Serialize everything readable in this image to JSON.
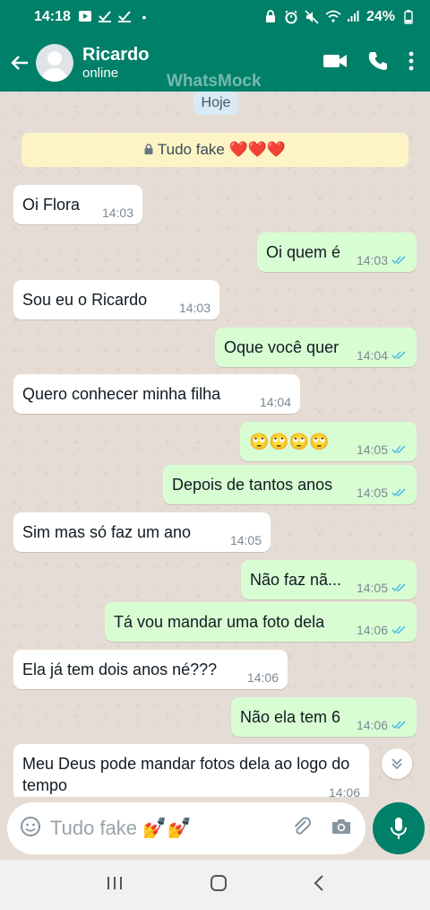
{
  "status_bar": {
    "time": "14:18",
    "battery": "24%",
    "left_icons": [
      "cast-icon",
      "check-icon",
      "check-icon",
      "dot-icon"
    ],
    "right_icons": [
      "lock-icon",
      "alarm-icon",
      "mute-icon",
      "wifi-icon",
      "signal-icon",
      "battery-icon"
    ]
  },
  "header": {
    "contact_name": "Ricardo",
    "contact_status": "online",
    "watermark": "WhatsMock"
  },
  "chat": {
    "date_label": "Hoje",
    "notice": "Tudo fake ❤️❤️❤️",
    "messages": [
      {
        "direction": "in",
        "text": "Oi Flora",
        "time": "14:03"
      },
      {
        "direction": "out",
        "text": "Oi quem é",
        "time": "14:03",
        "read": true
      },
      {
        "direction": "in",
        "text": "Sou eu o Ricardo",
        "time": "14:03"
      },
      {
        "direction": "out",
        "text": "Oque você quer",
        "time": "14:04",
        "read": true
      },
      {
        "direction": "in",
        "text": "Quero conhecer minha filha",
        "time": "14:04"
      },
      {
        "direction": "out",
        "text": "🙄🙄🙄🙄",
        "time": "14:05",
        "read": true
      },
      {
        "direction": "out",
        "text": "Depois de tantos anos",
        "time": "14:05",
        "read": true
      },
      {
        "direction": "in",
        "text": "Sim mas só faz um ano",
        "time": "14:05"
      },
      {
        "direction": "out",
        "text": "Não faz nã...",
        "time": "14:05",
        "read": true
      },
      {
        "direction": "out",
        "text": "Tá vou mandar uma foto dela",
        "time": "14:06",
        "read": true
      },
      {
        "direction": "in",
        "text": "Ela já tem dois anos né???",
        "time": "14:06"
      },
      {
        "direction": "out",
        "text": "Não ela tem 6",
        "time": "14:06",
        "read": true
      },
      {
        "direction": "in",
        "text": "Meu Deus pode mandar fotos dela ao logo do tempo",
        "time": "14:06"
      }
    ]
  },
  "composer": {
    "input_text": "Tudo fake 💅💅"
  },
  "colors": {
    "brand": "#008069",
    "outgoing_bubble": "#d9fdd3",
    "incoming_bubble": "#ffffff",
    "read_ticks": "#53bdeb"
  }
}
